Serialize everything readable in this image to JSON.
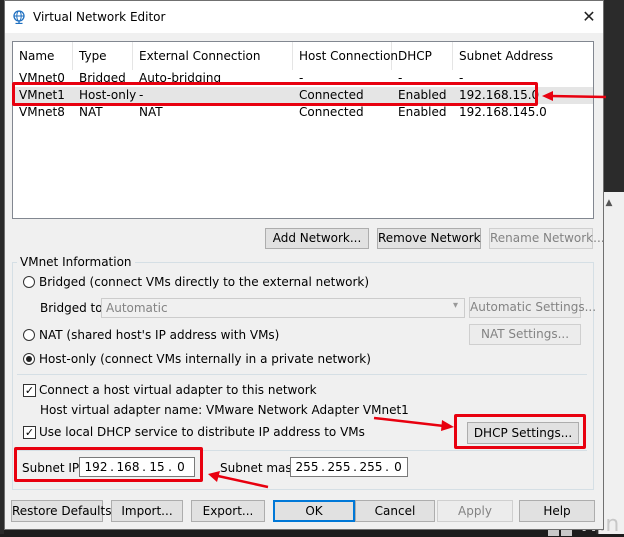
{
  "window": {
    "title": "Virtual Network Editor",
    "close_glyph": "✕"
  },
  "table": {
    "columns": [
      "Name",
      "Type",
      "External Connection",
      "Host Connection",
      "DHCP",
      "Subnet Address"
    ],
    "rows": [
      {
        "name": "VMnet0",
        "type": "Bridged",
        "external": "Auto-bridging",
        "host": "-",
        "dhcp": "-",
        "subnet": "-"
      },
      {
        "name": "VMnet1",
        "type": "Host-only",
        "external": "-",
        "host": "Connected",
        "dhcp": "Enabled",
        "subnet": "192.168.15.0"
      },
      {
        "name": "VMnet8",
        "type": "NAT",
        "external": "NAT",
        "host": "Connected",
        "dhcp": "Enabled",
        "subnet": "192.168.145.0"
      }
    ],
    "selected_row": "VMnet1"
  },
  "table_buttons": {
    "add": "Add Network...",
    "remove": "Remove Network",
    "rename": "Rename Network..."
  },
  "info": {
    "group_title": "VMnet Information",
    "bridged_label": "Bridged (connect VMs directly to the external network)",
    "bridged_to_label": "Bridged to:",
    "bridged_to_value": "Automatic",
    "auto_settings": "Automatic Settings...",
    "nat_label": "NAT (shared host's IP address with VMs)",
    "nat_settings": "NAT Settings...",
    "hostonly_label": "Host-only (connect VMs internally in a private network)",
    "selected_mode": "host-only",
    "connect_adapter_label": "Connect a host virtual adapter to this network",
    "connect_adapter_checked": true,
    "adapter_name_text": "Host virtual adapter name: VMware Network Adapter VMnet1",
    "dhcp_label": "Use local DHCP service to distribute IP address to VMs",
    "dhcp_checked": true,
    "dhcp_settings": "DHCP Settings...",
    "subnet_ip_label": "Subnet IP:",
    "subnet_ip": [
      "192",
      "168",
      "15",
      "0"
    ],
    "subnet_mask_label": "Subnet mask:",
    "subnet_mask": [
      "255",
      "255",
      "255",
      "0"
    ],
    "dot": "."
  },
  "footer": {
    "restore": "Restore Defaults",
    "import": "Import...",
    "export": "Export...",
    "ok": "OK",
    "cancel": "Cancel",
    "apply": "Apply",
    "help": "Help"
  },
  "background": {
    "windows_watermark": "Win"
  },
  "annotation_color": "#e8000f",
  "check_glyph": "✓",
  "dropdown_glyph": "▾",
  "scroll_glyph": "▲"
}
